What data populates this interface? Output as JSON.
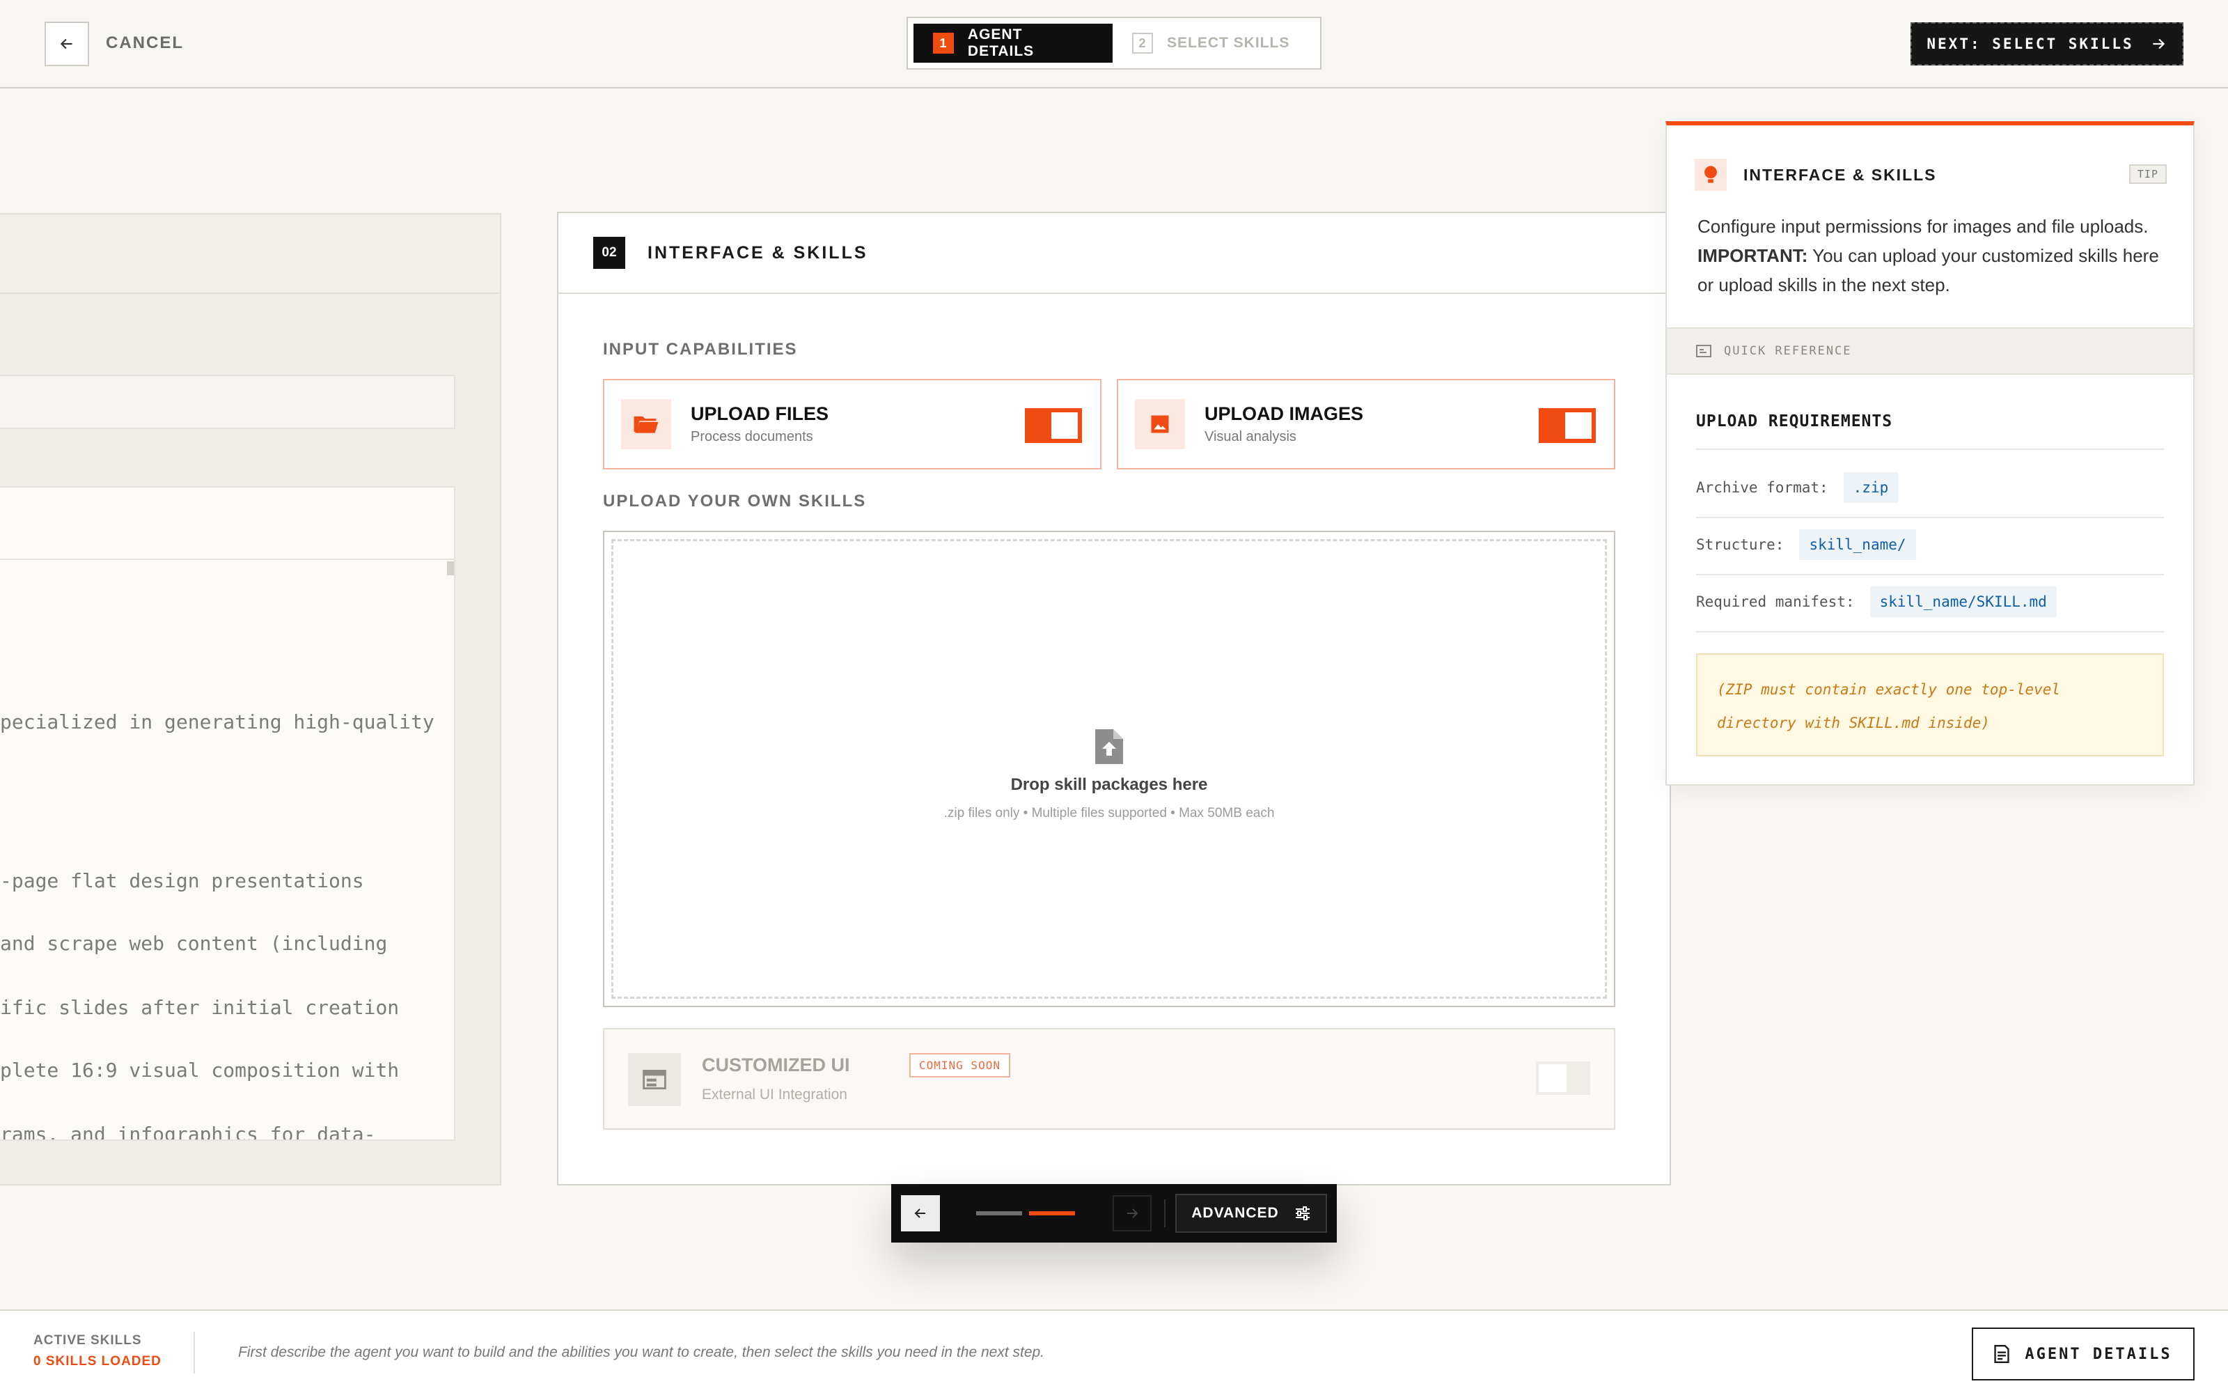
{
  "header": {
    "cancel_label": "CANCEL",
    "steps": [
      {
        "num": "1",
        "label": "AGENT DETAILS",
        "active": true
      },
      {
        "num": "2",
        "label": "SELECT SKILLS",
        "active": false
      }
    ],
    "next_label": "NEXT: SELECT SKILLS"
  },
  "left_panel": {
    "lines": [
      "pecialized in generating high-quality",
      "-page flat design presentations",
      "and scrape web content (including",
      "ific slides after initial creation",
      "plete 16:9 visual composition with",
      "rams, and infographics for data-"
    ]
  },
  "main": {
    "step_number": "02",
    "title": "INTERFACE & SKILLS",
    "input_capabilities_label": "INPUT CAPABILITIES",
    "capabilities": [
      {
        "title": "UPLOAD FILES",
        "subtitle": "Process documents",
        "icon": "folder-open-icon",
        "enabled": true
      },
      {
        "title": "UPLOAD IMAGES",
        "subtitle": "Visual analysis",
        "icon": "image-icon",
        "enabled": true
      }
    ],
    "upload_skills_label": "UPLOAD YOUR OWN SKILLS",
    "dropzone": {
      "title": "Drop skill packages here",
      "subtitle": ".zip files only • Multiple files supported • Max 50MB each"
    },
    "custom_ui": {
      "title": "CUSTOMIZED UI",
      "badge": "COMING SOON",
      "subtitle": "External UI Integration",
      "enabled": false
    }
  },
  "floating_nav": {
    "advanced_label": "ADVANCED"
  },
  "tip": {
    "title": "INTERFACE & SKILLS",
    "badge": "TIP",
    "body_intro": "Configure input permissions for images and file uploads. ",
    "body_strong": "IMPORTANT:",
    "body_rest": " You can upload your customized skills here or upload skills in the next step.",
    "quick_ref_label": "QUICK REFERENCE",
    "requirements_title": "UPLOAD REQUIREMENTS",
    "requirements": [
      {
        "label": "Archive format:",
        "value": ".zip"
      },
      {
        "label": "Structure:",
        "value": "skill_name/"
      },
      {
        "label": "Required manifest:",
        "value": "skill_name/SKILL.md"
      }
    ],
    "note": "(ZIP must contain exactly one top-level directory with SKILL.md inside)"
  },
  "footer": {
    "active_skills_label": "ACTIVE SKILLS",
    "skills_loaded": "0 SKILLS LOADED",
    "hint": "First describe the agent you want to build and the abilities you want to create, then select the skills you need in the next step.",
    "agent_details_label": "AGENT DETAILS"
  },
  "colors": {
    "accent": "#ef4b12",
    "dark": "#0f0f0f",
    "background": "#f8f6f2"
  }
}
